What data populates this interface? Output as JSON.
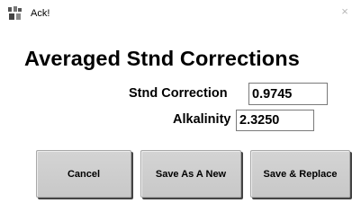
{
  "window": {
    "title": "Ack!",
    "close_glyph": "×",
    "icon": "app-icon"
  },
  "heading": "Averaged Stnd Corrections",
  "fields": {
    "stnd_correction": {
      "label": "Stnd Correction",
      "value": "0.9745"
    },
    "alkalinity": {
      "label": "Alkalinity",
      "value": "2.3250"
    }
  },
  "buttons": {
    "cancel": "Cancel",
    "save_as_new": "Save As A New",
    "save_replace": "Save & Replace"
  },
  "colors": {
    "button_face": "#cccccc",
    "button_shadow": "#444444",
    "input_border": "#7a7a7a"
  }
}
